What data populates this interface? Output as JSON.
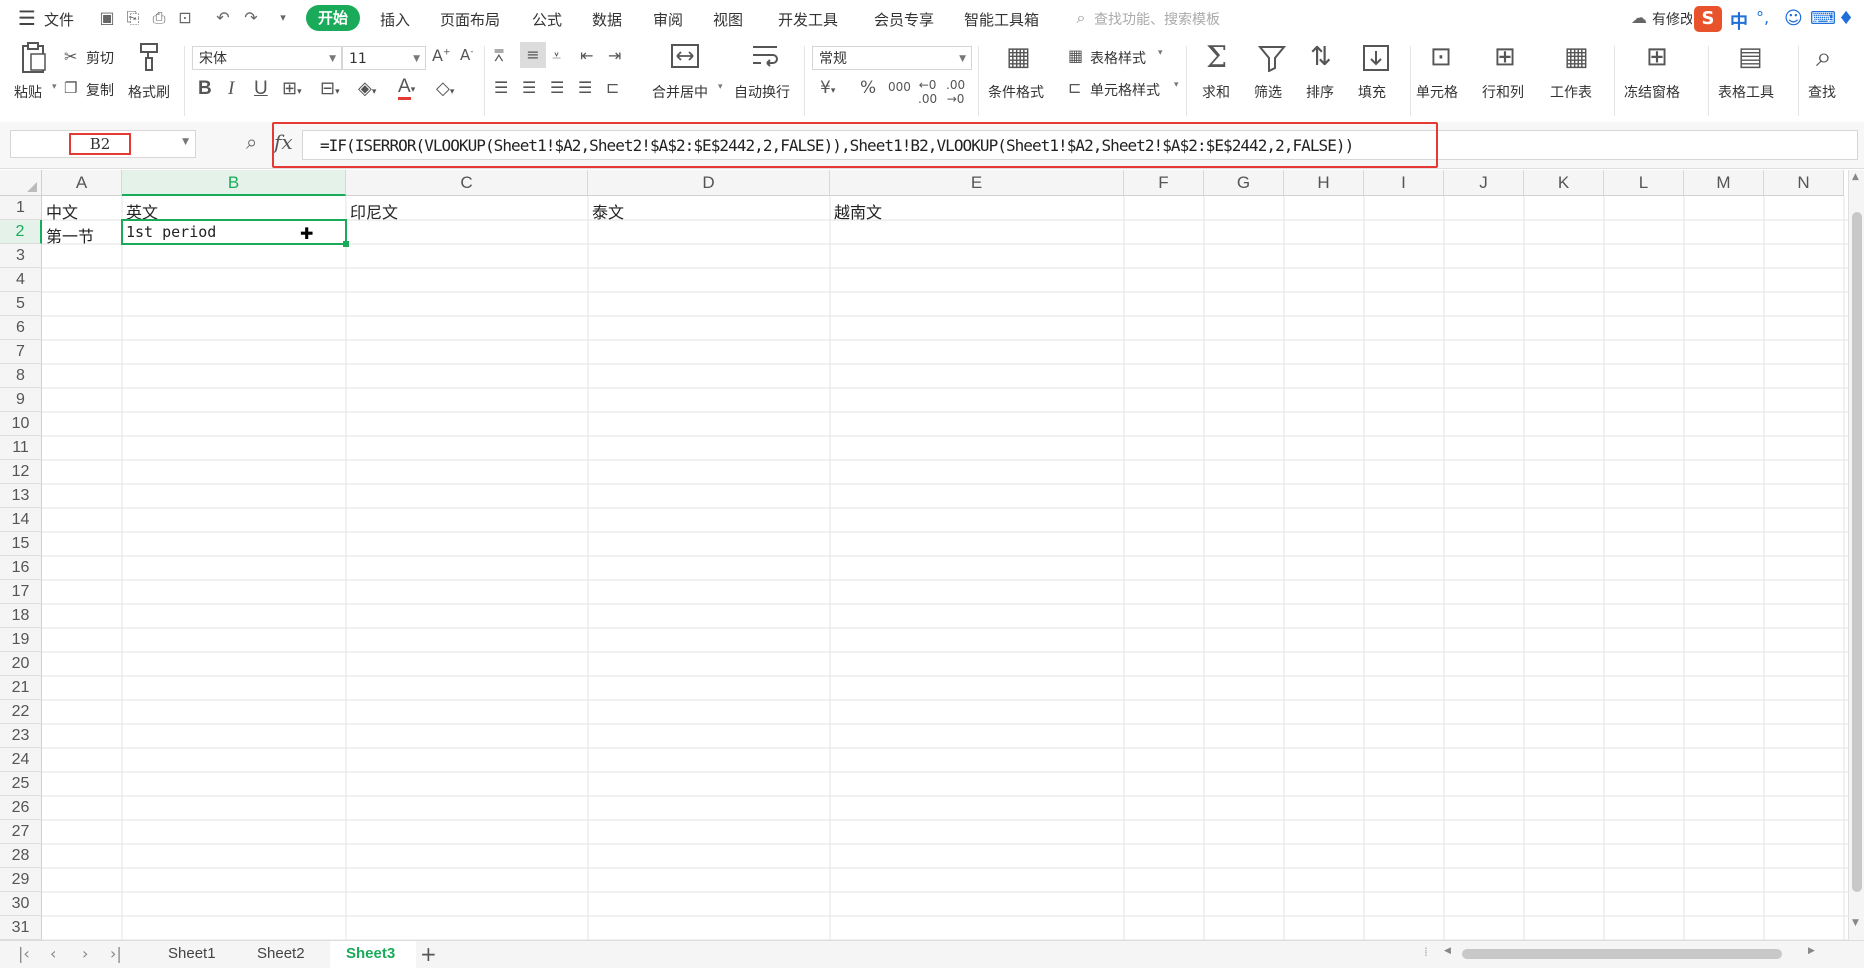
{
  "menubar": {
    "file": "文件",
    "tabs": [
      "开始",
      "插入",
      "页面布局",
      "公式",
      "数据",
      "审阅",
      "视图",
      "开发工具",
      "会员专享",
      "智能工具箱"
    ],
    "search_placeholder": "查找功能、搜索模板",
    "right_label": "有修改",
    "ime": [
      "中",
      "°,"
    ]
  },
  "ribbon": {
    "paste": "粘贴",
    "cut": "剪切",
    "copy": "复制",
    "format_painter": "格式刷",
    "font_name": "宋体",
    "font_size": "11",
    "merge_center": "合并居中",
    "wrap_text": "自动换行",
    "number_format": "常规",
    "table_style": "表格样式",
    "cond_format": "条件格式",
    "cell_style": "单元格样式",
    "sum": "求和",
    "filter": "筛选",
    "sort": "排序",
    "fill": "填充",
    "cell": "单元格",
    "row_col": "行和列",
    "worksheet": "工作表",
    "freeze": "冻结窗格",
    "table_tools": "表格工具",
    "find": "查找"
  },
  "formula_bar": {
    "name_box": "B2",
    "fx": "fx",
    "formula": "=IF(ISERROR(VLOOKUP(Sheet1!$A2,Sheet2!$A$2:$E$2442,2,FALSE)),Sheet1!B2,VLOOKUP(Sheet1!$A2,Sheet2!$A$2:$E$2442,2,FALSE))"
  },
  "grid": {
    "columns": [
      "A",
      "B",
      "C",
      "D",
      "E",
      "F",
      "G",
      "H",
      "I",
      "J",
      "K",
      "L",
      "M",
      "N"
    ],
    "rows": [
      "1",
      "2",
      "3",
      "4",
      "5",
      "6",
      "7",
      "8",
      "9",
      "10",
      "11",
      "12",
      "13",
      "14",
      "15",
      "16",
      "17",
      "18",
      "19",
      "20",
      "21",
      "22",
      "23",
      "24",
      "25",
      "26",
      "27",
      "28",
      "29",
      "30",
      "31"
    ],
    "header_row": [
      "中文",
      "英文",
      "印尼文",
      "泰文",
      "越南文"
    ],
    "row2": [
      "第一节",
      "1st period"
    ]
  },
  "sheets": {
    "tabs": [
      "Sheet1",
      "Sheet2",
      "Sheet3"
    ],
    "active": "Sheet3"
  },
  "colors": {
    "accent": "#1aab5a",
    "highlight": "#e53935"
  }
}
